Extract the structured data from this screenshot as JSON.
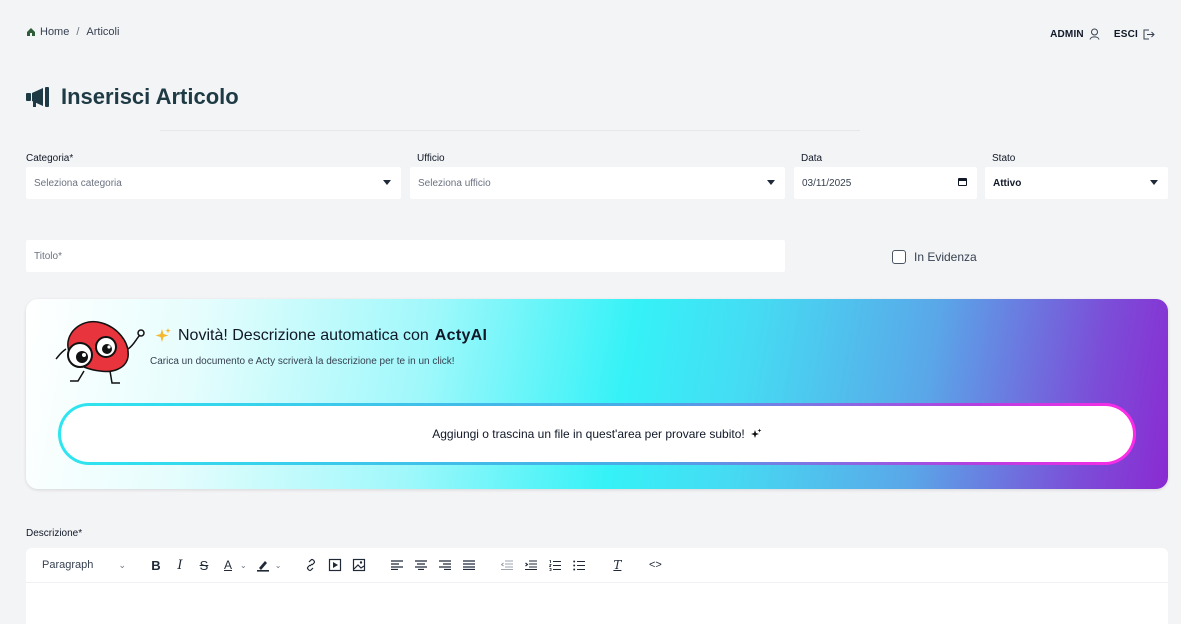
{
  "breadcrumb": {
    "home": "Home",
    "separator": "/",
    "current": "Articoli"
  },
  "user": {
    "name": "ADMIN",
    "logout": "ESCI"
  },
  "page": {
    "title": "Inserisci Articolo"
  },
  "form": {
    "categoria": {
      "label": "Categoria*",
      "placeholder": "Seleziona categoria"
    },
    "ufficio": {
      "label": "Ufficio",
      "placeholder": "Seleziona ufficio"
    },
    "data": {
      "label": "Data",
      "value": "03/11/2025"
    },
    "stato": {
      "label": "Stato",
      "value": "Attivo"
    },
    "titolo": {
      "placeholder": "Titolo*"
    },
    "evidenza": {
      "label": "In Evidenza"
    }
  },
  "banner": {
    "title_prefix": "Novità! Descrizione automatica con",
    "title_brand": "ActyAI",
    "subtitle": "Carica un documento e Acty scriverà la descrizione per te in un click!",
    "dropzone": "Aggiungi o trascina un file in quest'area per provare subito!"
  },
  "editor": {
    "label": "Descrizione*",
    "block_format": "Paragraph"
  },
  "colors": {
    "accent": "#1e3a44",
    "cyan": "#35f2f7",
    "magenta": "#ff2ae6",
    "mascot_red": "#e8343c"
  }
}
